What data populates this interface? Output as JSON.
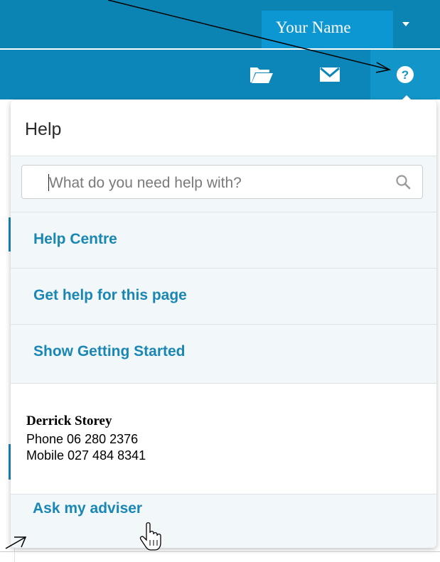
{
  "header": {
    "username": "Your Name"
  },
  "toolbar": {
    "icons": [
      "folder-icon",
      "mail-icon",
      "help-icon"
    ]
  },
  "help_panel": {
    "title": "Help",
    "search": {
      "placeholder": "What do you need help with?",
      "value": ""
    },
    "links": [
      "Help Centre",
      "Get help for this page",
      "Show Getting Started"
    ],
    "adviser": {
      "name": "Derrick Storey",
      "phone": "Phone 06 280 2376",
      "mobile": "Mobile 027 484 8341"
    },
    "ask_label": "Ask my adviser"
  },
  "colors": {
    "topbar": "#0c84b3",
    "accent_link": "#1a86b4",
    "panel_bg": "#f2f8fa"
  }
}
